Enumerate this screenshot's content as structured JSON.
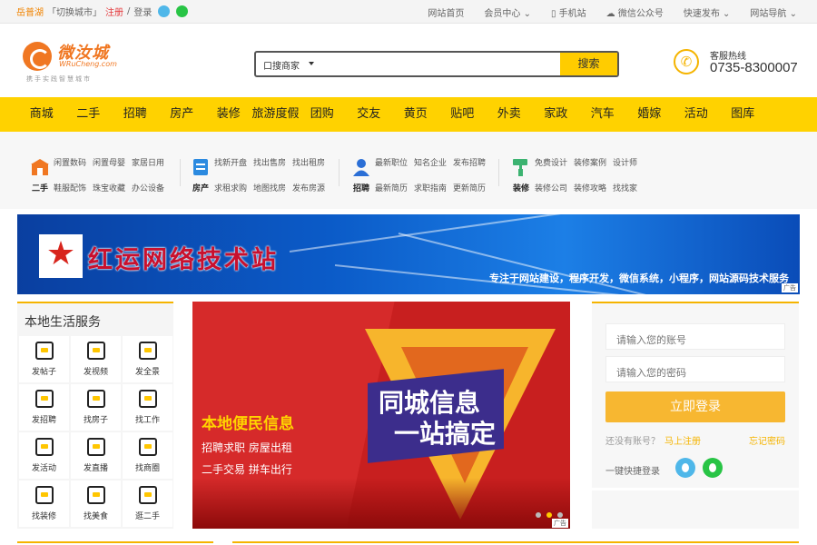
{
  "topbar": {
    "city": "岳普湖",
    "switch_city": "「切换城市」",
    "register": "注册",
    "separator": "/",
    "login": "登录",
    "links": [
      "网站首页",
      "会员中心",
      "手机站",
      "微信公众号",
      "快速发布",
      "网站导航"
    ]
  },
  "header": {
    "logo_name": "微汝城",
    "logo_en": "WRuCheng.com",
    "logo_slogan": "携手实践智慧城市",
    "search_select": "口搜商家",
    "search_button": "搜索",
    "hotline_label": "客服热线",
    "hotline_number": "0735-8300007"
  },
  "nav": [
    "商城",
    "二手",
    "招聘",
    "房产",
    "装修",
    "旅游度假",
    "团购",
    "交友",
    "黄页",
    "贴吧",
    "外卖",
    "家政",
    "汽车",
    "婚嫁",
    "活动",
    "图库"
  ],
  "quick": [
    {
      "label": "二手",
      "links": [
        "闲置数码",
        "闲置母婴",
        "家居日用",
        "鞋服配饰",
        "珠宝收藏",
        "办公设备"
      ]
    },
    {
      "label": "房产",
      "links": [
        "找新开盘",
        "找出售房",
        "找出租房",
        "求租求购",
        "地图找房",
        "发布房源"
      ]
    },
    {
      "label": "招聘",
      "links": [
        "最新职位",
        "知名企业",
        "发布招聘",
        "最新简历",
        "求职指南",
        "更新简历"
      ]
    },
    {
      "label": "装修",
      "links": [
        "免费设计",
        "装修案例",
        "设计师",
        "装修公司",
        "装修攻略",
        "找找家"
      ]
    }
  ],
  "banner": {
    "title": "红运网络技术站",
    "subtitle": "专注于网站建设，程序开发，微信系统，小程序，网站源码技术服务",
    "ad": "广告"
  },
  "services": {
    "title": "本地生活服务",
    "items": [
      "发帖子",
      "发视频",
      "发全景",
      "发招聘",
      "找房子",
      "找工作",
      "发活动",
      "发直播",
      "找商圈",
      "找装修",
      "找美食",
      "逛二手"
    ]
  },
  "carousel": {
    "heading": "本地便民信息",
    "lines": [
      "招聘求职  房屋出租",
      "二手交易  拼车出行"
    ],
    "big1": "同城信息",
    "big2": "一站搞定",
    "ad": "广告"
  },
  "login": {
    "account_placeholder": "请输入您的账号",
    "password_placeholder": "请输入您的密码",
    "button": "立即登录",
    "no_account": "还没有账号？",
    "register_now": "马上注册",
    "forgot": "忘记密码",
    "quick_login": "一键快捷登录"
  },
  "colors": {
    "brand_yellow": "#ffd200",
    "accent_orange": "#f07722",
    "login_button": "#f7b731"
  }
}
